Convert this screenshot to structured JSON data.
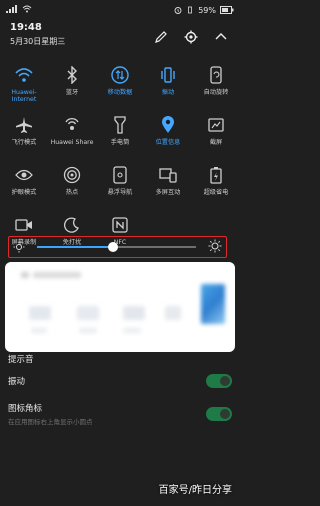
{
  "status_bar": {
    "left_text": "",
    "battery": "59%"
  },
  "header": {
    "time": "19:48",
    "date": "5月30日星期三"
  },
  "tiles": [
    {
      "label": "Huawei-\nInternet",
      "icon": "wifi-icon",
      "active": true
    },
    {
      "label": "蓝牙",
      "icon": "bluetooth-icon",
      "active": false
    },
    {
      "label": "移动数据",
      "icon": "mobile-data-icon",
      "active": true
    },
    {
      "label": "振动",
      "icon": "vibrate-icon",
      "active": true
    },
    {
      "label": "自动旋转",
      "icon": "auto-rotate-icon",
      "active": false
    },
    {
      "label": "飞行模式",
      "icon": "airplane-icon",
      "active": false
    },
    {
      "label": "Huawei Share",
      "icon": "huawei-share-icon",
      "active": false
    },
    {
      "label": "手电筒",
      "icon": "flashlight-icon",
      "active": false
    },
    {
      "label": "位置信息",
      "icon": "location-icon",
      "active": true
    },
    {
      "label": "截屏",
      "icon": "screenshot-icon",
      "active": false
    },
    {
      "label": "护眼模式",
      "icon": "eye-comfort-icon",
      "active": false
    },
    {
      "label": "热点",
      "icon": "hotspot-icon",
      "active": false
    },
    {
      "label": "悬浮导航",
      "icon": "floating-nav-icon",
      "active": false
    },
    {
      "label": "多屏互动",
      "icon": "multi-screen-icon",
      "active": false
    },
    {
      "label": "超级省电",
      "icon": "power-saving-icon",
      "active": false
    },
    {
      "label": "屏幕录制",
      "icon": "screen-record-icon",
      "active": false
    },
    {
      "label": "免打扰",
      "icon": "do-not-disturb-icon",
      "active": false
    },
    {
      "label": "NFC",
      "icon": "nfc-icon",
      "active": false
    }
  ],
  "brightness": {
    "level": 0.48
  },
  "settings": [
    {
      "title": "提示音",
      "subtitle": "",
      "toggle": false
    },
    {
      "title": "振动",
      "subtitle": "",
      "toggle": true
    },
    {
      "title": "图标角标",
      "subtitle": "在应用图标右上角显示小圆点",
      "toggle": true
    }
  ],
  "watermark": "百家号/昨日分享",
  "colors": {
    "accent": "#45a7ff",
    "highlight_border": "#e0282b",
    "toggle_on": "#1e7a47"
  }
}
